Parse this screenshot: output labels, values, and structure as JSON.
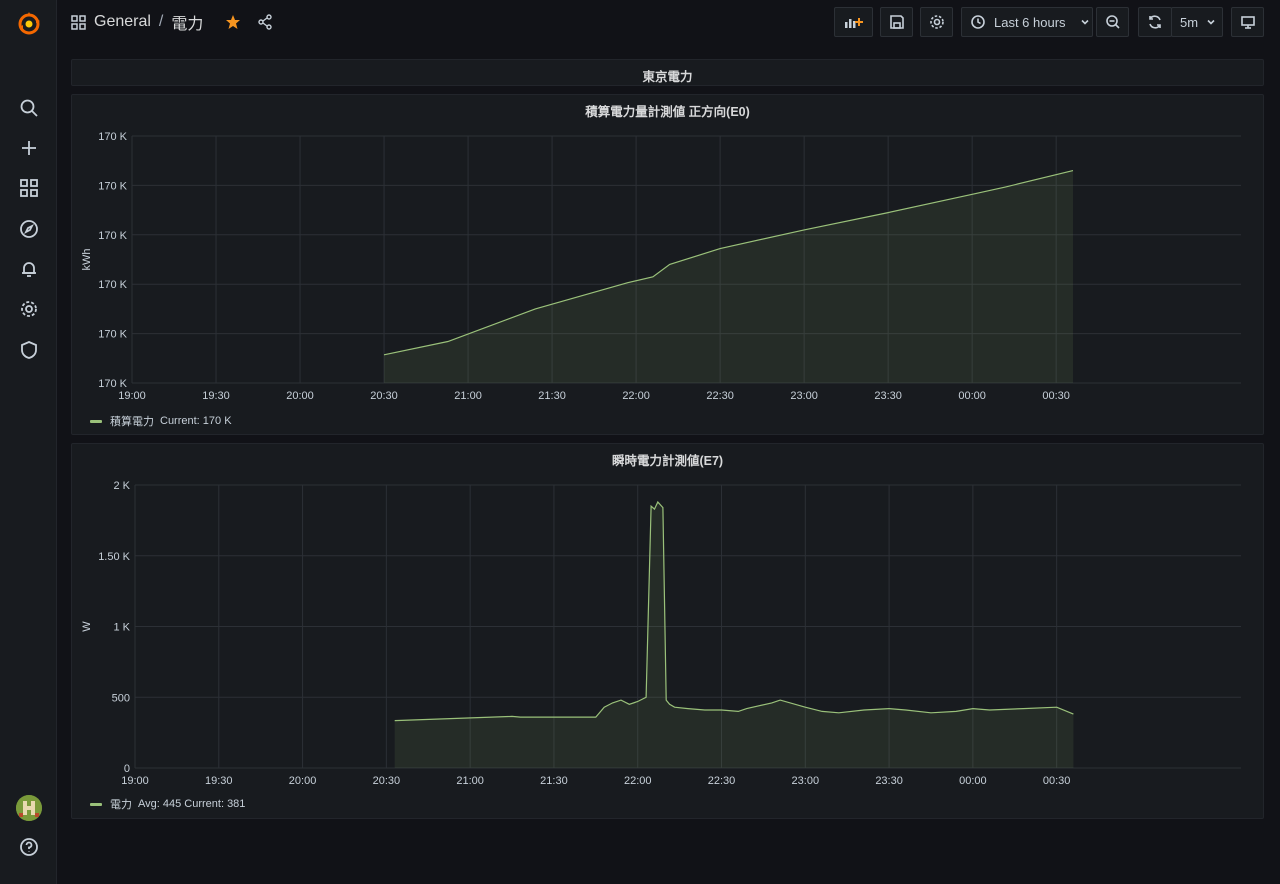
{
  "nav": {
    "folder": "General",
    "separator": "/",
    "dashboard": "電力",
    "time_range": "Last 6 hours",
    "refresh": "5m"
  },
  "row": {
    "title": "東京電力"
  },
  "panels": [
    {
      "title": "積算電力量計測値 正方向(E0)",
      "legend_name": "積算電力",
      "legend_stats": "Current: 170 K"
    },
    {
      "title": "瞬時電力計測値(E7)",
      "legend_name": "電力",
      "legend_stats": "Avg: 445  Current: 381"
    }
  ],
  "chart_data": [
    {
      "type": "area",
      "title": "積算電力量計測値 正方向(E0)",
      "ylabel": "kWh",
      "y_tick_labels": [
        "170 K",
        "170 K",
        "170 K",
        "170 K",
        "170 K",
        "170 K"
      ],
      "x_tick_labels": [
        "19:00",
        "19:30",
        "20:00",
        "20:30",
        "21:00",
        "21:30",
        "22:00",
        "22:30",
        "23:00",
        "23:30",
        "00:00",
        "00:30"
      ],
      "x_range_hours": [
        19.0,
        25.6
      ],
      "y_range_normalized": [
        0,
        5
      ],
      "series": [
        {
          "name": "積算電力",
          "color": "#9ac17a",
          "x_hours": [
            20.5,
            20.88,
            21.4,
            21.95,
            22.1,
            22.2,
            22.5,
            23.0,
            23.5,
            24.0,
            24.2,
            24.6
          ],
          "y_normalized": [
            0.57,
            0.84,
            1.5,
            2.03,
            2.15,
            2.4,
            2.72,
            3.1,
            3.45,
            3.82,
            3.97,
            4.3
          ]
        }
      ],
      "legend": "bottom-left",
      "grid": true
    },
    {
      "type": "area",
      "title": "瞬時電力計測値(E7)",
      "ylabel": "W",
      "y_tick_labels": [
        "0",
        "500",
        "1 K",
        "1.50 K",
        "2 K"
      ],
      "x_tick_labels": [
        "19:00",
        "19:30",
        "20:00",
        "20:30",
        "21:00",
        "21:30",
        "22:00",
        "22:30",
        "23:00",
        "23:30",
        "00:00",
        "00:30"
      ],
      "x_range_hours": [
        19.0,
        25.6
      ],
      "ylim": [
        0,
        2000
      ],
      "series": [
        {
          "name": "電力",
          "color": "#9ac17a",
          "x_hours": [
            20.55,
            21.25,
            21.3,
            21.75,
            21.8,
            21.85,
            21.9,
            21.95,
            22.0,
            22.05,
            22.08,
            22.1,
            22.12,
            22.15,
            22.17,
            22.19,
            22.22,
            22.3,
            22.4,
            22.5,
            22.6,
            22.65,
            22.8,
            22.85,
            23.0,
            23.1,
            23.2,
            23.35,
            23.5,
            23.6,
            23.75,
            23.9,
            24.0,
            24.1,
            24.3,
            24.5,
            24.6
          ],
          "y": [
            335,
            365,
            360,
            360,
            430,
            460,
            480,
            450,
            470,
            500,
            1850,
            1830,
            1880,
            1840,
            480,
            450,
            430,
            420,
            410,
            410,
            400,
            420,
            460,
            480,
            430,
            400,
            390,
            410,
            420,
            410,
            390,
            400,
            420,
            410,
            420,
            430,
            381
          ]
        }
      ],
      "avg": 445,
      "current": 381,
      "legend": "bottom-left",
      "grid": true
    }
  ]
}
